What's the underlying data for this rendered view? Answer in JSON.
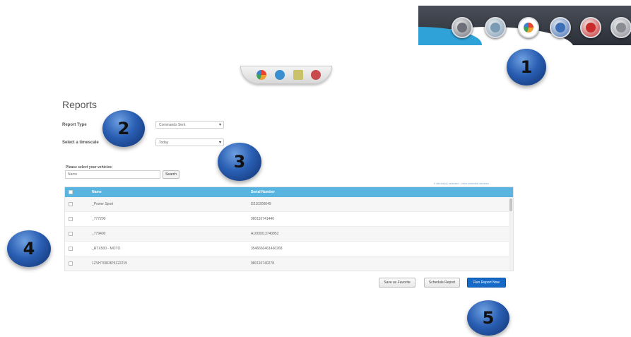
{
  "toolbar_icons": [
    {
      "name": "gray-circle-icon",
      "color": "#6e7079"
    },
    {
      "name": "map-icon",
      "color": "#7a9bb4"
    },
    {
      "name": "pie-chart-icon",
      "color": "#f0a030"
    },
    {
      "name": "home-icon",
      "color": "#3d6fb8"
    },
    {
      "name": "help-icon",
      "color": "#c92a2a"
    },
    {
      "name": "power-icon",
      "color": "#8a8c94"
    }
  ],
  "mini_toolbar_icons": [
    {
      "name": "pie-chart-icon",
      "color": "#f0a030"
    },
    {
      "name": "globe-icon",
      "color": "#3a8fd0"
    },
    {
      "name": "list-icon",
      "color": "#c9c26a"
    },
    {
      "name": "heart-icon",
      "color": "#c94a4a"
    }
  ],
  "callouts": [
    "1",
    "2",
    "3",
    "4",
    "5"
  ],
  "page_title": "Reports",
  "form": {
    "report_type_label": "Report Type",
    "report_type_value": "Commands Sent",
    "timescale_label": "Select a timescale",
    "timescale_value": "Today"
  },
  "vehicles": {
    "label": "Please select your vehicles:",
    "placeholder": "Name",
    "search_label": "Search",
    "selection_info": "0 device(s) selected - view selected devices"
  },
  "table": {
    "columns": [
      "Name",
      "Serial Number"
    ],
    "rows": [
      {
        "name": "_Power Sport",
        "serial": "D210200049"
      },
      {
        "name": "_777200",
        "serial": "980110741440"
      },
      {
        "name": "_779400",
        "serial": "A1000013740852"
      },
      {
        "name": "_RTX500 - MOTO",
        "serial": "3546660461460268"
      },
      {
        "name": "1ZVHT09F8P5122215",
        "serial": "980110740278"
      }
    ]
  },
  "buttons": {
    "save_favorite": "Save as Favorite",
    "schedule": "Schedule Report",
    "run_now": "Run Report Now"
  },
  "colors": {
    "accent": "#5ab4e0",
    "primary_button": "#1769c7",
    "toolbar_dark": "#2b2f38",
    "callout_blue": "#2a5fb3"
  }
}
